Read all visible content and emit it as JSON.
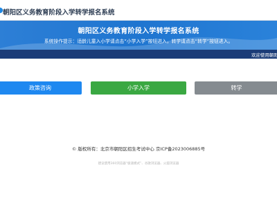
{
  "header": {
    "site_title": "朝阳区义务教育阶段入学转学报名系统"
  },
  "banner": {
    "title": "朝阳区义务教育阶段入学转学报名系统",
    "notice": "系统操作提示：适龄儿童入小学请点击“小学入学”按钮进入，转学请点击“转学”按钮进入。",
    "welcome": "欢迎使用朝阳"
  },
  "buttons": {
    "policy": "政策咨询",
    "primary_enroll": "小学入学",
    "transfer": "转学"
  },
  "footer": {
    "copyright": "© 版权所有：北京市朝阳区招生考试中心    京ICP备2023006885号",
    "browser_hint": "建议使用360浏览器“极速模式”、谷歌浏览器、火狐浏览器"
  },
  "colors": {
    "banner_blue": "#1f75d0",
    "banner_strip": "#1b3c78",
    "policy_button": "#1e88f0",
    "enroll_button": "#3aa842",
    "transfer_button": "#858b90"
  }
}
